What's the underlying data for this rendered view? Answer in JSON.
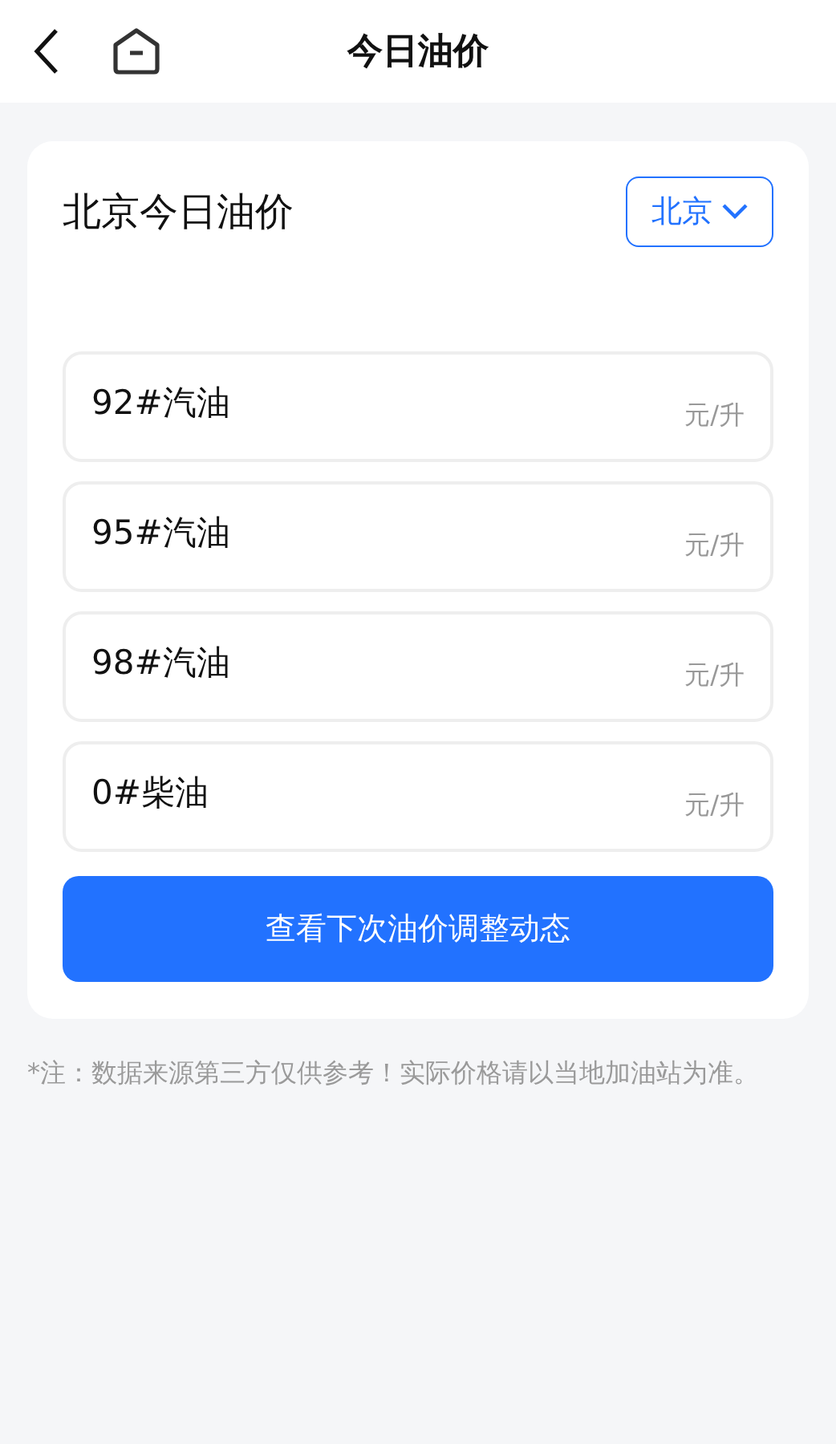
{
  "header": {
    "title": "今日油价"
  },
  "card": {
    "title": "北京今日油价",
    "city": "北京"
  },
  "prices": [
    {
      "name": "92#汽油",
      "unit": "元/升"
    },
    {
      "name": "95#汽油",
      "unit": "元/升"
    },
    {
      "name": "98#汽油",
      "unit": "元/升"
    },
    {
      "name": "0#柴油",
      "unit": "元/升"
    }
  ],
  "action": {
    "label": "查看下次油价调整动态"
  },
  "note": "*注：数据来源第三方仅供参考！实际价格请以当地加油站为准。"
}
